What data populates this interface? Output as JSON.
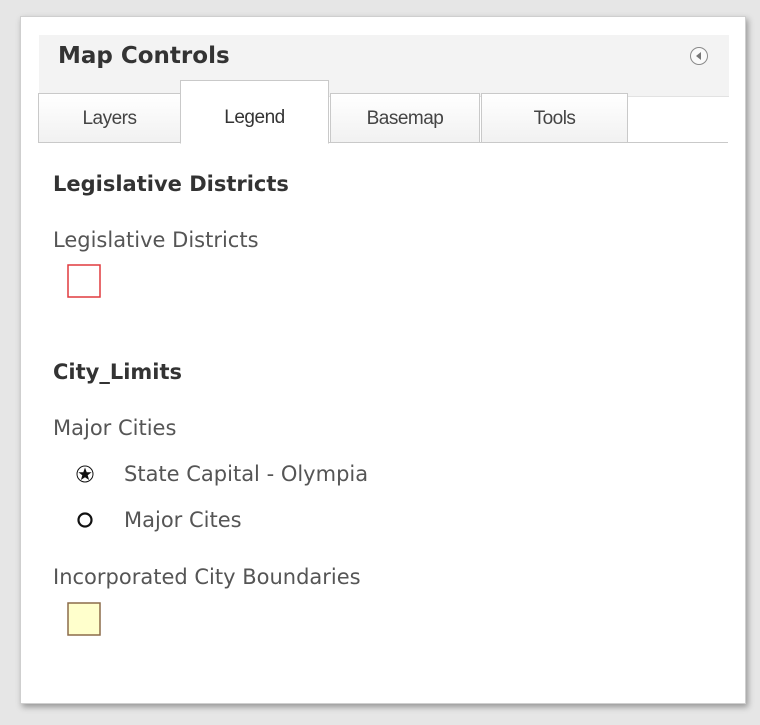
{
  "header": {
    "title": "Map Controls",
    "collapse_icon": "collapse-left-icon"
  },
  "tabs": [
    {
      "label": "Layers",
      "active": false
    },
    {
      "label": "Legend",
      "active": true
    },
    {
      "label": "Basemap",
      "active": false
    },
    {
      "label": "Tools",
      "active": false
    }
  ],
  "legend": {
    "sections": [
      {
        "title": "Legislative Districts",
        "layers": [
          {
            "label": "Legislative Districts",
            "symbol": "polygon-outline",
            "stroke": "#e03a3e",
            "fill": "#ffffff"
          }
        ]
      },
      {
        "title": "City_Limits",
        "layers": [
          {
            "label": "Major Cities",
            "items": [
              {
                "label": "State Capital - Olympia",
                "icon": "star-in-circle-icon"
              },
              {
                "label": "Major Cites",
                "icon": "circle-icon"
              }
            ]
          },
          {
            "label": "Incorporated City Boundaries",
            "symbol": "polygon-filled",
            "stroke": "#8c6b4a",
            "fill": "#ffffcc"
          }
        ]
      }
    ]
  }
}
